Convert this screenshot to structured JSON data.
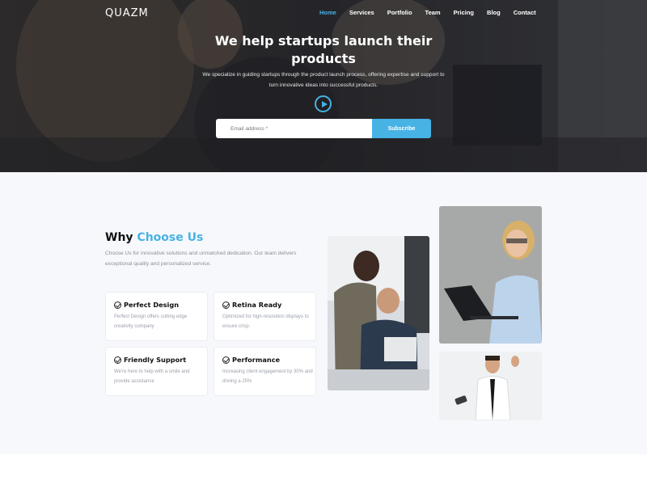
{
  "brand": {
    "logo": "QUAZM",
    "accent": "#47b2e4"
  },
  "nav": {
    "items": [
      {
        "label": "Home",
        "active": true
      },
      {
        "label": "Services",
        "active": false
      },
      {
        "label": "Portfolio",
        "active": false
      },
      {
        "label": "Team",
        "active": false
      },
      {
        "label": "Pricing",
        "active": false
      },
      {
        "label": "Blog",
        "active": false
      },
      {
        "label": "Contact",
        "active": false
      }
    ]
  },
  "hero": {
    "title_line1": "We help startups launch their",
    "title_line2": "products",
    "subtitle": "We specialize in guiding startups through the product launch process, offering expertise and support to turn innovative ideas into successful products.",
    "play_icon": "play-circle-icon",
    "email_placeholder": "Email address *",
    "subscribe_label": "Subscribe"
  },
  "why": {
    "title_prefix": "Why ",
    "title_accent": "Choose Us",
    "description": "Choose Us for innovative solutions and unmatched dedication. Our team delivers exceptional quality and personalized service.",
    "features": [
      {
        "icon": "check-circle-icon",
        "title": "Perfect Design",
        "text": "Perfect Design offers cutting edge creativity company"
      },
      {
        "icon": "check-circle-icon",
        "title": "Retina Ready",
        "text": "Optimized for high-resolution displays to ensure crisp."
      },
      {
        "icon": "check-circle-icon",
        "title": "Friendly Support",
        "text": "We're here to help with a smile and provide assistance"
      },
      {
        "icon": "check-circle-icon",
        "title": "Performance",
        "text": "Increasing client engagement by 30% and driving a 25%"
      }
    ]
  }
}
